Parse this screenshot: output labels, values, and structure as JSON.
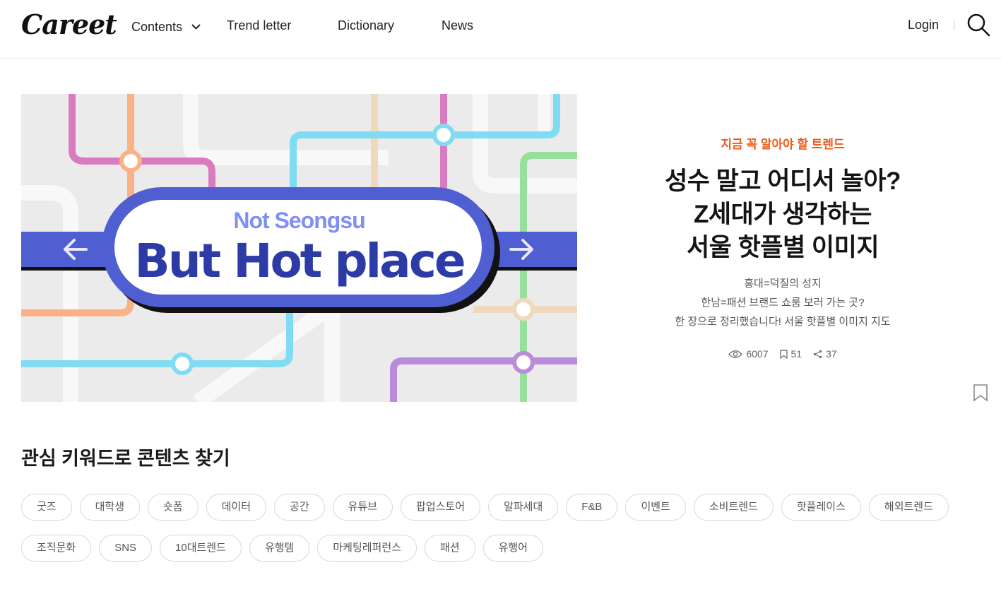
{
  "header": {
    "logo": "Careet",
    "nav": {
      "contents": "Contents",
      "trend_letter": "Trend letter",
      "dictionary": "Dictionary",
      "news": "News"
    },
    "login": "Login"
  },
  "hero": {
    "banner_subtitle": "Not Seongsu",
    "banner_title": "But Hot place",
    "kicker": "지금 꼭 알아야 할 트렌드",
    "headline_lines": [
      "성수 말고 어디서 놀아?",
      "Z세대가 생각하는",
      "서울 핫플별 이미지"
    ],
    "summary_lines": [
      "홍대=덕질의 성지",
      "한남=패션 브랜드 쇼룸 보러 가는 곳?",
      "한 장으로 정리했습니다! 서울 핫플별 이미지 지도"
    ],
    "stats": {
      "views": "6007",
      "bookmarks": "51",
      "shares": "37"
    },
    "accent_color": "#ef5a16"
  },
  "keywords": {
    "title": "관심 키워드로 콘텐츠 찾기",
    "rows": [
      [
        "굿즈",
        "대학생",
        "숏폼",
        "데이터",
        "공간",
        "유튜브",
        "팝업스토어",
        "알파세대",
        "F&B",
        "이벤트",
        "소비트렌드",
        "핫플레이스",
        "해외트렌드"
      ],
      [
        "조직문화",
        "SNS",
        "10대트렌드",
        "유행템",
        "마케팅레퍼런스",
        "패션",
        "유행어"
      ]
    ]
  }
}
